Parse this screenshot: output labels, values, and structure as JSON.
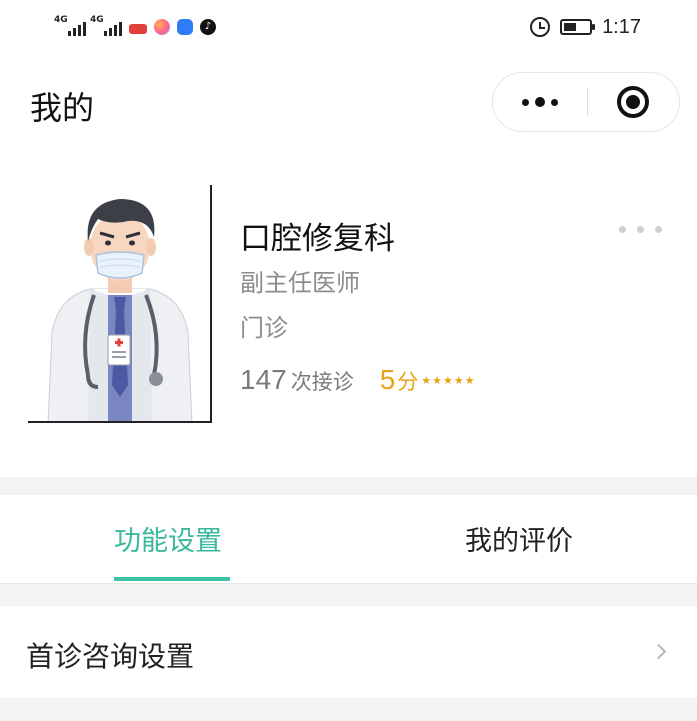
{
  "status_bar": {
    "network_1": "4G",
    "network_2": "4G",
    "time": "1:17",
    "icons": [
      "signal-icon",
      "signal-icon",
      "weibo-icon",
      "photo-app-icon",
      "blue-app-icon",
      "tiktok-icon",
      "alarm-icon",
      "battery-icon"
    ]
  },
  "header": {
    "title": "我的"
  },
  "profile": {
    "department": "口腔修复科",
    "title": "副主任医师",
    "clinic_type": "门诊",
    "visit_count": "147",
    "visit_label": "次接诊",
    "score": "5",
    "score_unit": "分",
    "stars": 5,
    "accent_color": "#e8a317"
  },
  "tabs": [
    {
      "label": "功能设置",
      "active": true
    },
    {
      "label": "我的评价",
      "active": false
    }
  ],
  "list": [
    {
      "label": "首诊咨询设置"
    }
  ],
  "colors": {
    "active_tab": "#39b89b",
    "underline": "#3cc2a2",
    "background": "#f3f3f3"
  }
}
